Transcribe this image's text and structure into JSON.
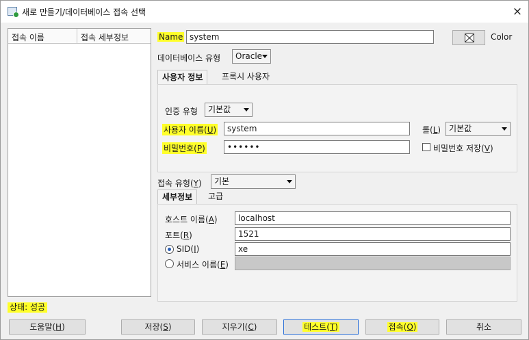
{
  "window": {
    "title": "새로 만들기/데이터베이스 접속 선택",
    "close_glyph": "×"
  },
  "connection_list": {
    "columns": [
      "접속 이름",
      "접속 세부정보"
    ]
  },
  "form": {
    "name_label": "Name",
    "name_value": "system",
    "color_button_label": "Color",
    "db_type_label": "데이터베이스 유형",
    "db_type_value": "Oracle",
    "tabs_top": [
      "사용자 정보",
      "프록시 사용자"
    ],
    "auth_type_label": "인증 유형",
    "auth_type_value": "기본값",
    "username_label": "사용자 이름",
    "username_key": "U",
    "username_value": "system",
    "role_label": "롤",
    "role_key": "L",
    "role_value": "기본값",
    "password_label": "비밀번호",
    "password_key": "P",
    "password_value": "••••••",
    "save_password_label": "비밀번호 저장",
    "save_password_key": "V",
    "save_password_checked": false,
    "conn_type_label": "접속 유형",
    "conn_type_key": "Y",
    "conn_type_value": "기본",
    "tabs_bottom": [
      "세부정보",
      "고급"
    ],
    "hostname_label": "호스트 이름",
    "hostname_key": "A",
    "hostname_value": "localhost",
    "port_label": "포트",
    "port_key": "R",
    "port_value": "1521",
    "sid_label": "SID",
    "sid_key": "I",
    "sid_value": "xe",
    "sid_selected": true,
    "service_label": "서비스 이름",
    "service_key": "E",
    "service_value": ""
  },
  "status": {
    "text": "상태: 성공"
  },
  "buttons": {
    "help": {
      "label": "도움말",
      "key": "H"
    },
    "save": {
      "label": "저장",
      "key": "S"
    },
    "clear": {
      "label": "지우기",
      "key": "C"
    },
    "test": {
      "label": "테스트",
      "key": "T"
    },
    "connect": {
      "label": "접속",
      "key": "O"
    },
    "cancel": {
      "label": "취소"
    }
  },
  "colors": {
    "highlight": "#ffff2a",
    "window_bg": "#f0f0f0",
    "success_icon": "#2e9a3e"
  }
}
